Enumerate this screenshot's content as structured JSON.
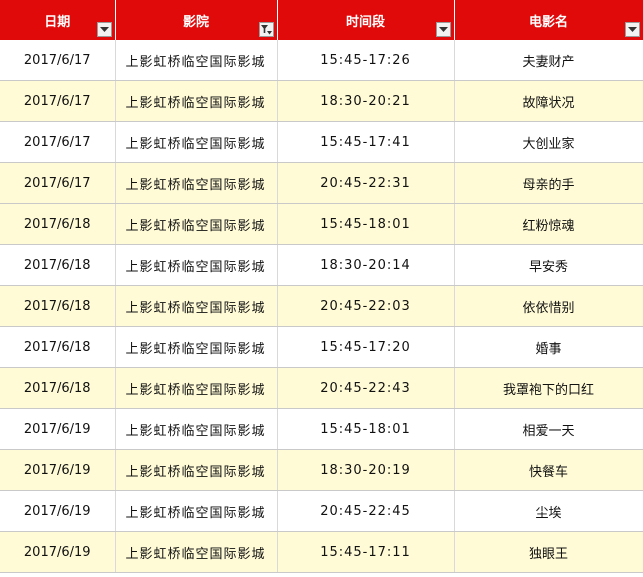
{
  "headers": {
    "date": "日期",
    "cinema": "影院",
    "time": "时间段",
    "movie": "电影名"
  },
  "filter_icons": {
    "date": "dropdown-arrow-icon",
    "cinema": "filter-active-icon",
    "time": "dropdown-arrow-icon",
    "movie": "dropdown-arrow-icon"
  },
  "colors": {
    "header_bg": "#e10a0a",
    "header_text": "#ffffff",
    "band_row": "#fffbd6"
  },
  "rows": [
    {
      "date": "2017/6/17",
      "cinema": "上影虹桥临空国际影城",
      "time": "15:45-17:26",
      "movie": "夫妻财产"
    },
    {
      "date": "2017/6/17",
      "cinema": "上影虹桥临空国际影城",
      "time": "18:30-20:21",
      "movie": "故障状况"
    },
    {
      "date": "2017/6/17",
      "cinema": "上影虹桥临空国际影城",
      "time": "15:45-17:41",
      "movie": "大创业家"
    },
    {
      "date": "2017/6/17",
      "cinema": "上影虹桥临空国际影城",
      "time": "20:45-22:31",
      "movie": "母亲的手"
    },
    {
      "date": "2017/6/18",
      "cinema": "上影虹桥临空国际影城",
      "time": "15:45-18:01",
      "movie": "红粉惊魂"
    },
    {
      "date": "2017/6/18",
      "cinema": "上影虹桥临空国际影城",
      "time": "18:30-20:14",
      "movie": "早安秀"
    },
    {
      "date": "2017/6/18",
      "cinema": "上影虹桥临空国际影城",
      "time": "20:45-22:03",
      "movie": "依依惜别"
    },
    {
      "date": "2017/6/18",
      "cinema": "上影虹桥临空国际影城",
      "time": "15:45-17:20",
      "movie": "婚事"
    },
    {
      "date": "2017/6/18",
      "cinema": "上影虹桥临空国际影城",
      "time": "20:45-22:43",
      "movie": "我罩袍下的口红"
    },
    {
      "date": "2017/6/19",
      "cinema": "上影虹桥临空国际影城",
      "time": "15:45-18:01",
      "movie": "相爱一天"
    },
    {
      "date": "2017/6/19",
      "cinema": "上影虹桥临空国际影城",
      "time": "18:30-20:19",
      "movie": "快餐车"
    },
    {
      "date": "2017/6/19",
      "cinema": "上影虹桥临空国际影城",
      "time": "20:45-22:45",
      "movie": "尘埃"
    },
    {
      "date": "2017/6/19",
      "cinema": "上影虹桥临空国际影城",
      "time": "15:45-17:11",
      "movie": "独眼王"
    }
  ]
}
